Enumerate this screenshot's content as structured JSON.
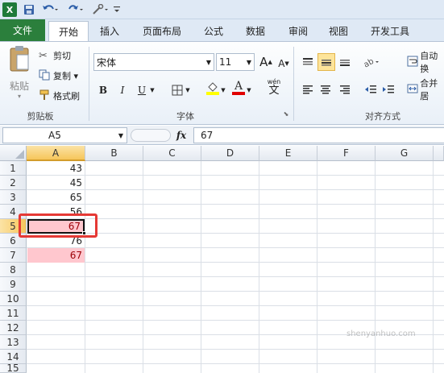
{
  "qat": {
    "app_icon": "X",
    "save_icon": "save-icon",
    "undo_icon": "undo-icon",
    "redo_icon": "redo-icon",
    "customize_icon": "customize-icon"
  },
  "tabs": [
    {
      "label": "文件"
    },
    {
      "label": "开始"
    },
    {
      "label": "插入"
    },
    {
      "label": "页面布局"
    },
    {
      "label": "公式"
    },
    {
      "label": "数据"
    },
    {
      "label": "审阅"
    },
    {
      "label": "视图"
    },
    {
      "label": "开发工具"
    }
  ],
  "ribbon": {
    "clipboard": {
      "paste": "粘贴",
      "cut": "剪切",
      "copy": "复制 ▾",
      "format_painter": "格式刷",
      "label": "剪贴板"
    },
    "font": {
      "name": "宋体",
      "size": "11",
      "grow": "A",
      "shrink": "A",
      "bold": "B",
      "italic": "I",
      "underline": "U",
      "wen": "wén",
      "wen_char": "文",
      "label": "字体"
    },
    "align": {
      "wrap": "自动换",
      "merge": "合并居",
      "label": "对齐方式"
    }
  },
  "formula_bar": {
    "name_box": "A5",
    "fx": "fx",
    "value": "67"
  },
  "grid": {
    "columns": [
      "A",
      "B",
      "C",
      "D",
      "E",
      "F",
      "G"
    ],
    "rows": [
      "1",
      "2",
      "3",
      "4",
      "5",
      "6",
      "7",
      "8",
      "9",
      "10",
      "11",
      "12",
      "13",
      "14",
      "15"
    ],
    "cells_a": [
      "43",
      "45",
      "65",
      "56",
      "67",
      "76",
      "67"
    ],
    "highlight_color": "#ffc7ce",
    "highlight_text_color": "#9c0006",
    "annotation_color": "#e53935"
  },
  "watermark": "shenyanhuo.com"
}
